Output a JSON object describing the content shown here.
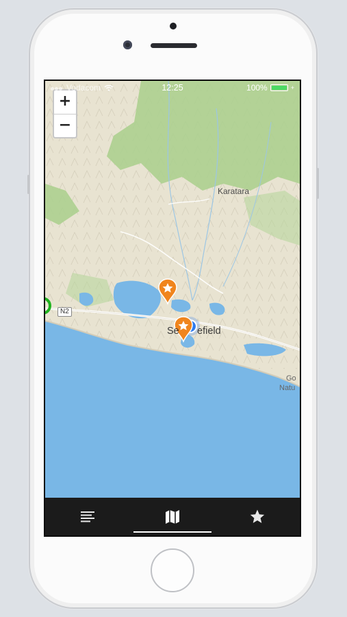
{
  "status_bar": {
    "carrier": "Vodacom",
    "time": "12:25",
    "battery": "100%",
    "battery_level": 1.0
  },
  "map": {
    "zoom_in_label": "+",
    "zoom_out_label": "−",
    "place_labels": {
      "karatara": "Karatara",
      "sedgefield_left": "Se",
      "sedgefield_right": "efield",
      "goukamma_line1": "Go",
      "goukamma_line2": "Natu"
    },
    "road_shield": "N2",
    "markers": [
      {
        "type": "favorite",
        "icon": "star-pin-icon",
        "color": "#f0851d"
      },
      {
        "type": "favorite",
        "icon": "star-pin-icon",
        "color": "#f0851d"
      },
      {
        "type": "current-location",
        "icon": "location-dot-icon",
        "color": "#2f7cf0"
      },
      {
        "type": "route-start",
        "icon": "green-ring-icon",
        "color": "#1fb31f"
      }
    ],
    "colors": {
      "sea": "#79b7e6",
      "forest": "#a9cf8c",
      "land": "#e9e4d4"
    }
  },
  "tab_bar": {
    "tabs": [
      {
        "name": "list",
        "icon": "list-icon",
        "active": false
      },
      {
        "name": "map",
        "icon": "map-icon",
        "active": true
      },
      {
        "name": "favorites",
        "icon": "star-icon",
        "active": false
      }
    ]
  }
}
